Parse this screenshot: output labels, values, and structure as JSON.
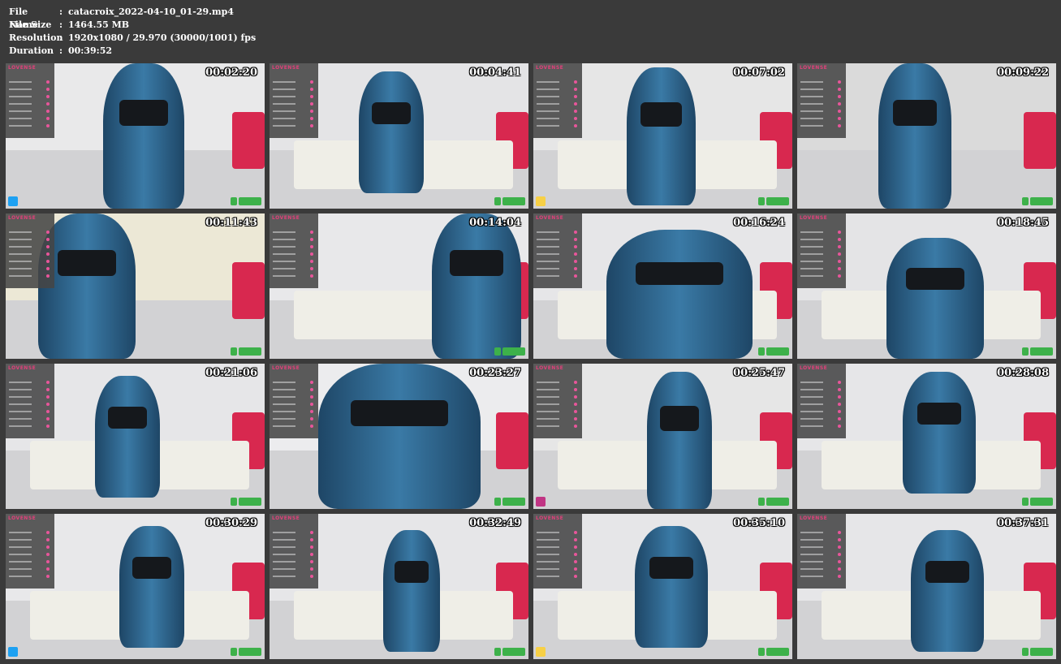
{
  "info": {
    "file_name_label": "File Name",
    "file_name": "catacroix_2022-04-10_01-29.mp4",
    "file_size_label": "File Size",
    "file_size": "1464.55 MB",
    "resolution_label": "Resolution",
    "resolution": "1920x1080 / 29.970 (30000/1001) fps",
    "duration_label": "Duration",
    "duration": "00:39:52",
    "separator": ":"
  },
  "overlay_brand": "LOVENSE",
  "thumbnails": [
    {
      "timestamp": "00:02:20"
    },
    {
      "timestamp": "00:04:41"
    },
    {
      "timestamp": "00:07:02"
    },
    {
      "timestamp": "00:09:22"
    },
    {
      "timestamp": "00:11:43"
    },
    {
      "timestamp": "00:14:04"
    },
    {
      "timestamp": "00:16:24"
    },
    {
      "timestamp": "00:18:45"
    },
    {
      "timestamp": "00:21:06"
    },
    {
      "timestamp": "00:23:27"
    },
    {
      "timestamp": "00:25:47"
    },
    {
      "timestamp": "00:28:08"
    },
    {
      "timestamp": "00:30:29"
    },
    {
      "timestamp": "00:32:49"
    },
    {
      "timestamp": "00:35:10"
    },
    {
      "timestamp": "00:37:31"
    }
  ],
  "colors": {
    "background": "#3a3a3a",
    "latex_blue": "#2e5f86",
    "sofa": "#ecebe4",
    "accent_pink": "#e0407a",
    "dmca_green": "#3db14a"
  }
}
